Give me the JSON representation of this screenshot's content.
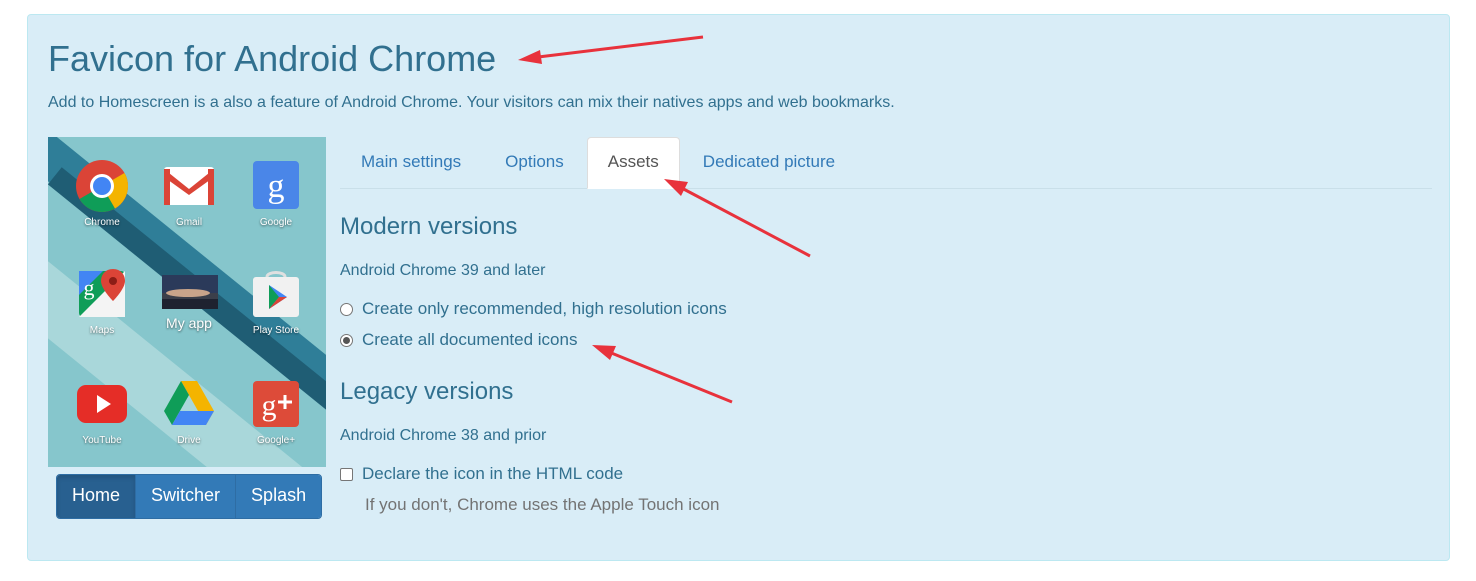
{
  "header": {
    "title": "Favicon for Android Chrome",
    "subtitle": "Add to Homescreen is a also a feature of Android Chrome. Your visitors can mix their natives apps and web bookmarks."
  },
  "preview": {
    "apps": [
      {
        "label": "Chrome",
        "icon": "chrome-icon"
      },
      {
        "label": "Gmail",
        "icon": "gmail-icon"
      },
      {
        "label": "Google",
        "icon": "google-icon"
      },
      {
        "label": "Maps",
        "icon": "maps-icon"
      },
      {
        "label": "My app",
        "icon": "my-app-icon"
      },
      {
        "label": "Play Store",
        "icon": "play-store-icon"
      },
      {
        "label": "YouTube",
        "icon": "youtube-icon"
      },
      {
        "label": "Drive",
        "icon": "drive-icon"
      },
      {
        "label": "Google+",
        "icon": "google-plus-icon"
      }
    ],
    "view_buttons": [
      "Home",
      "Switcher",
      "Splash"
    ],
    "active_view": "Home"
  },
  "tabs": [
    {
      "label": "Main settings"
    },
    {
      "label": "Options"
    },
    {
      "label": "Assets"
    },
    {
      "label": "Dedicated picture"
    }
  ],
  "active_tab": "Assets",
  "modern": {
    "heading": "Modern versions",
    "note": "Android Chrome 39 and later",
    "options": [
      {
        "label": "Create only recommended, high resolution icons",
        "checked": false
      },
      {
        "label": "Create all documented icons",
        "checked": true
      }
    ]
  },
  "legacy": {
    "heading": "Legacy versions",
    "note": "Android Chrome 38 and prior",
    "checkbox_label": "Declare the icon in the HTML code",
    "checkbox_checked": false,
    "hint": "If you don't, Chrome uses the Apple Touch icon"
  },
  "colors": {
    "panel_bg": "#d9edf7",
    "text": "#31708f",
    "link": "#337ab7",
    "button": "#337ab7",
    "arrow": "#e8323c"
  }
}
